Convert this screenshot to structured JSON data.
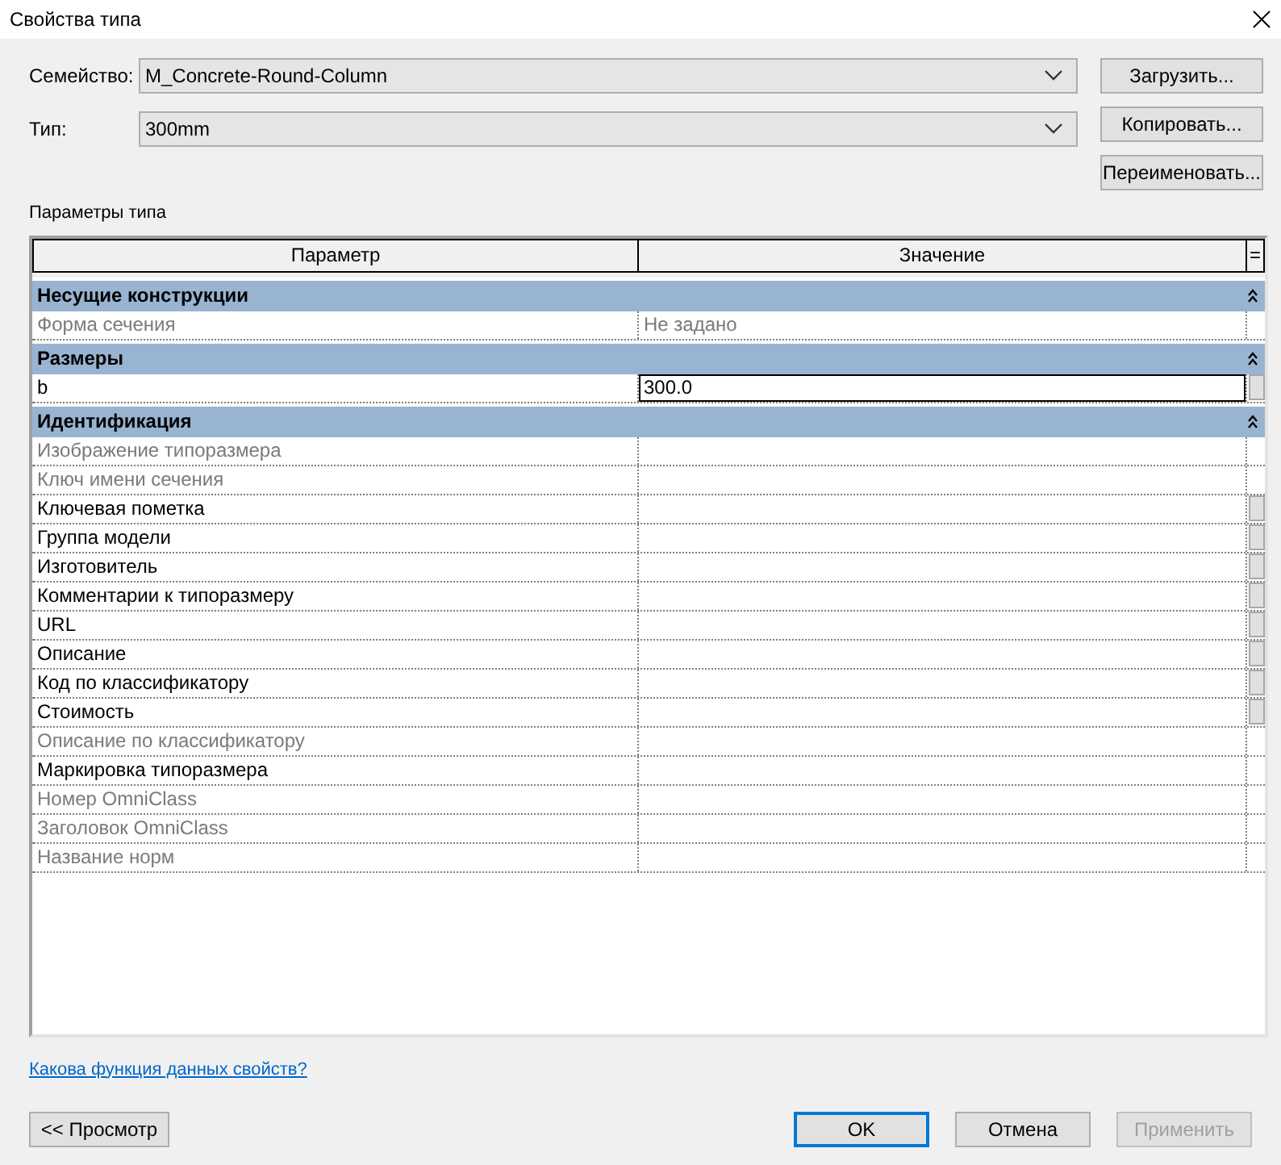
{
  "window": {
    "title": "Свойства типа"
  },
  "family": {
    "label": "Семейство:",
    "value": "M_Concrete-Round-Column"
  },
  "type": {
    "label": "Тип:",
    "value": "300mm"
  },
  "side_buttons": [
    "Загрузить...",
    "Копировать...",
    "Переименовать..."
  ],
  "section_label": "Параметры типа",
  "table": {
    "columns": [
      "Параметр",
      "Значение",
      "="
    ],
    "groups": [
      {
        "name": "Несущие конструкции",
        "expanded": true,
        "params": [
          {
            "name": "Форма сечения",
            "value": "Не задано",
            "disabled": true,
            "editing": false,
            "has_button": false
          }
        ]
      },
      {
        "name": "Размеры",
        "expanded": true,
        "params": [
          {
            "name": "b",
            "value": "300.0",
            "disabled": false,
            "editing": true,
            "has_button": true
          }
        ]
      },
      {
        "name": "Идентификация",
        "expanded": true,
        "params": [
          {
            "name": "Изображение типоразмера",
            "disabled": true,
            "editing": false,
            "has_button": false
          },
          {
            "name": "Ключ имени сечения",
            "disabled": true,
            "editing": false,
            "has_button": false
          },
          {
            "name": "Ключевая пометка",
            "disabled": false,
            "editing": false,
            "has_button": true
          },
          {
            "name": "Группа модели",
            "disabled": false,
            "editing": false,
            "has_button": true
          },
          {
            "name": "Изготовитель",
            "disabled": false,
            "editing": false,
            "has_button": true
          },
          {
            "name": "Комментарии к типоразмеру",
            "disabled": false,
            "editing": false,
            "has_button": true
          },
          {
            "name": "URL",
            "disabled": false,
            "editing": false,
            "has_button": true
          },
          {
            "name": "Описание",
            "disabled": false,
            "editing": false,
            "has_button": true
          },
          {
            "name": "Код по классификатору",
            "disabled": false,
            "editing": false,
            "has_button": true
          },
          {
            "name": "Стоимость",
            "disabled": false,
            "editing": false,
            "has_button": true
          },
          {
            "name": "Описание по классификатору",
            "disabled": true,
            "editing": false,
            "has_button": false
          },
          {
            "name": "Маркировка типоразмера",
            "disabled": false,
            "editing": false,
            "has_button": false
          },
          {
            "name": "Номер OmniClass",
            "disabled": true,
            "editing": false,
            "has_button": false
          },
          {
            "name": "Заголовок OmniClass",
            "disabled": true,
            "editing": false,
            "has_button": false
          },
          {
            "name": "Название норм",
            "disabled": true,
            "editing": false,
            "has_button": false
          }
        ]
      }
    ]
  },
  "help_link": "Какова функция данных свойств?",
  "bottom_buttons": [
    {
      "label": "<< Просмотр",
      "kind": "preview",
      "disabled": false,
      "default": false
    },
    {
      "label": "OK",
      "kind": "action",
      "disabled": false,
      "default": true
    },
    {
      "label": "Отмена",
      "kind": "action",
      "disabled": false,
      "default": false
    },
    {
      "label": "Применить",
      "kind": "action",
      "disabled": true,
      "default": false
    }
  ]
}
